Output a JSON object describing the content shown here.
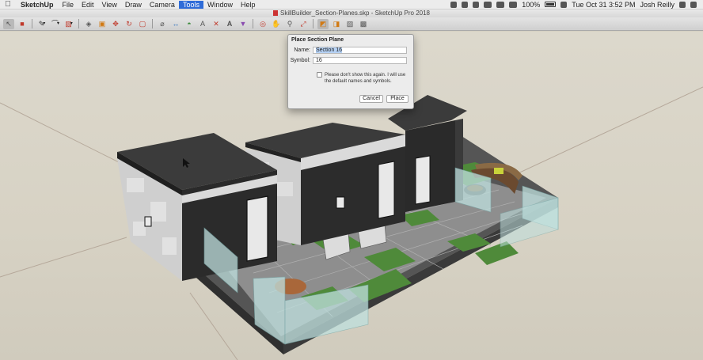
{
  "menubar": {
    "apple_icon": "apple-icon",
    "app_name": "SketchUp",
    "items": [
      "File",
      "Edit",
      "View",
      "Draw",
      "Camera",
      "Tools",
      "Window",
      "Help"
    ],
    "active_item": "Tools",
    "battery": "100%",
    "datetime": "Tue Oct 31  3:52 PM",
    "user": "Josh Reilly"
  },
  "window": {
    "title": "SkillBuilder_Section-Planes.skp - SketchUp Pro 2018"
  },
  "toolbar": {
    "tools": [
      "select-tool",
      "eraser-tool",
      "line-tool",
      "arc-tool",
      "shape-tool",
      "push-pull-tool",
      "offset-tool",
      "move-tool",
      "rotate-tool",
      "scale-tool",
      "tape-measure-tool",
      "dimension-tool",
      "protractor-tool",
      "text-tool",
      "axes-tool",
      "3d-text-tool",
      "paint-bucket-tool",
      "orbit-tool",
      "pan-tool",
      "zoom-tool",
      "zoom-extents-tool",
      "section-plane-tool",
      "display-section-planes",
      "display-section-cuts",
      "display-section-fill"
    ]
  },
  "dialog": {
    "title": "Place Section Plane",
    "name_label": "Name:",
    "name_value": "Section 16",
    "symbol_label": "Symbol:",
    "symbol_value": "16",
    "checkbox_text": "Please don't show this again.  I will use the default names and symbols.",
    "checkbox_checked": false,
    "cancel_label": "Cancel",
    "place_label": "Place"
  },
  "colors": {
    "background": "#d6d1c3",
    "roof": "#3a3a3a",
    "siding": "#2b2b2b",
    "stone_wall": "#cfcfcf",
    "patio": "#8f8f8f",
    "grass": "#4f8a3a",
    "glass": "#bfe0de"
  }
}
